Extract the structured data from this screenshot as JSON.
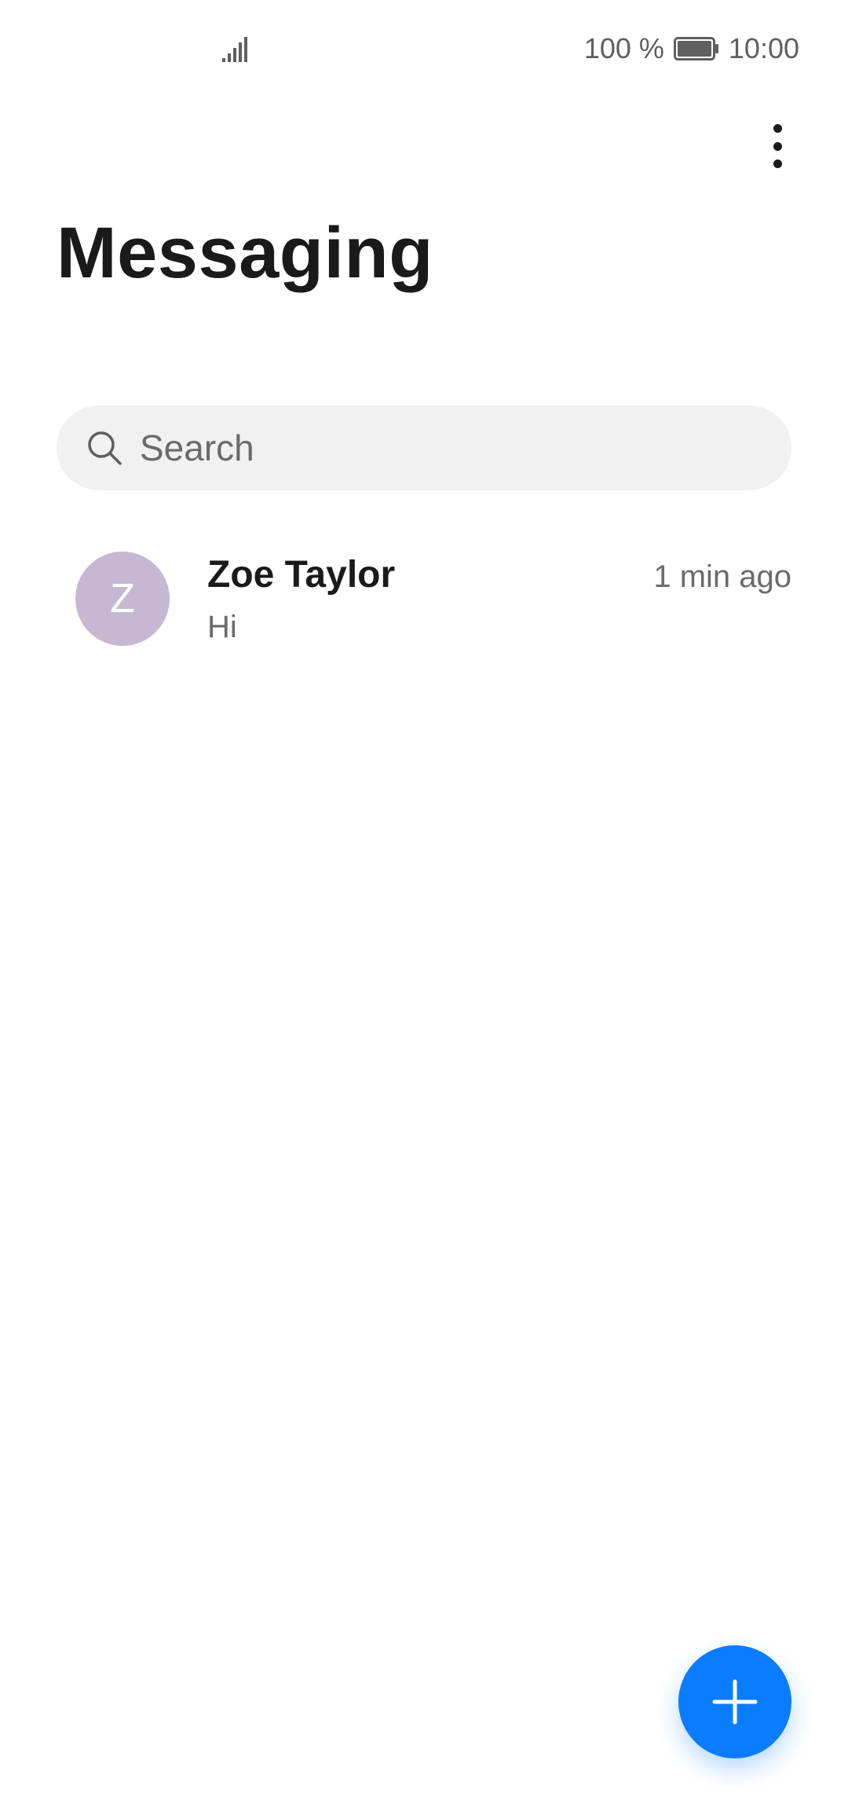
{
  "status_bar": {
    "battery_percent": "100 %",
    "time": "10:00",
    "signal_icon": "signal-bars-icon",
    "battery_icon": "battery-full-icon"
  },
  "header": {
    "title": "Messaging",
    "more_icon": "more-vertical-icon"
  },
  "search": {
    "placeholder": "Search",
    "value": "",
    "icon": "search-icon"
  },
  "conversations": [
    {
      "avatar_initial": "Z",
      "avatar_color": "#c6b8d2",
      "name": "Zoe Taylor",
      "preview": "Hi",
      "time": "1 min ago"
    }
  ],
  "fab": {
    "icon": "plus-icon",
    "color": "#0a7cff"
  }
}
